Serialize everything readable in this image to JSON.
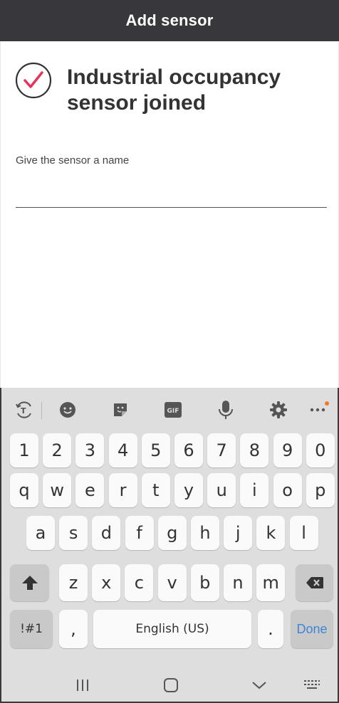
{
  "header": {
    "title": "Add sensor"
  },
  "status": {
    "icon": "check-circle-icon",
    "title": "Industrial occupancy sensor joined",
    "accent_color": "#e8325b"
  },
  "form": {
    "name_label": "Give the sensor a name",
    "name_value": ""
  },
  "keyboard": {
    "toolbar": [
      "text-translate-icon",
      "emoji-icon",
      "sticker-icon",
      "gif-icon",
      "microphone-icon",
      "settings-icon",
      "more-icon"
    ],
    "number_row": [
      "1",
      "2",
      "3",
      "4",
      "5",
      "6",
      "7",
      "8",
      "9",
      "0"
    ],
    "row1": [
      "q",
      "w",
      "e",
      "r",
      "t",
      "y",
      "u",
      "i",
      "o",
      "p"
    ],
    "row2": [
      "a",
      "s",
      "d",
      "f",
      "g",
      "h",
      "j",
      "k",
      "l"
    ],
    "row3": [
      "z",
      "x",
      "c",
      "v",
      "b",
      "n",
      "m"
    ],
    "symbols_label": "!#1",
    "comma_label": ",",
    "space_label": "English (US)",
    "period_label": ".",
    "done_label": "Done",
    "gif_label": "GIF"
  },
  "navbar": [
    "recent-apps-icon",
    "home-icon",
    "back-icon",
    "keyboard-icon"
  ]
}
